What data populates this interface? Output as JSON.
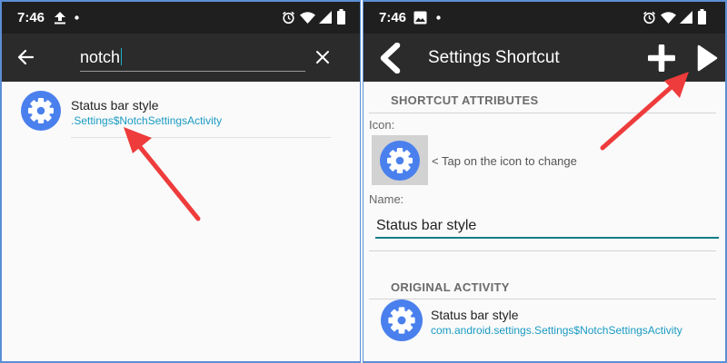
{
  "left_screen": {
    "status_bar": {
      "time": "7:46"
    },
    "search": {
      "query": "notch"
    },
    "results": [
      {
        "title": "Status bar style",
        "subtitle": ".Settings$NotchSettingsActivity",
        "icon": "settings-gear-icon"
      }
    ]
  },
  "right_screen": {
    "status_bar": {
      "time": "7:46"
    },
    "app_bar": {
      "title": "Settings Shortcut"
    },
    "shortcut_attributes": {
      "header": "SHORTCUT ATTRIBUTES",
      "icon_label": "Icon:",
      "icon_hint": "< Tap on the icon to change",
      "name_label": "Name:",
      "name_value": "Status bar style"
    },
    "original_activity": {
      "header": "ORIGINAL ACTIVITY",
      "title": "Status bar style",
      "subtitle": "com.android.settings.Settings$NotchSettingsActivity"
    }
  },
  "colors": {
    "toolbar": "#2b2b2b",
    "status_bar": "#1f1f1f",
    "gear_blue": "#4a80ed",
    "link_blue": "#1a9bc2",
    "teal_underline": "#0f7c86",
    "annotation_arrow": "#ee3b3b",
    "frame_border": "#5b8fd6"
  }
}
